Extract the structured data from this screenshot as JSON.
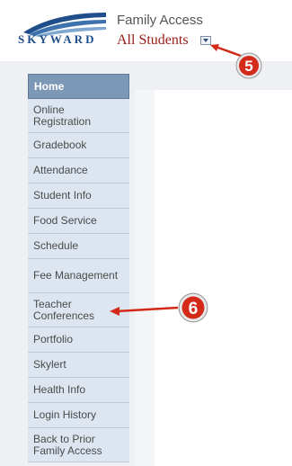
{
  "header": {
    "logo_text": "SKYWARD",
    "app_title": "Family Access",
    "student_selector": "All Students"
  },
  "sidebar": {
    "items": [
      {
        "label": "Home",
        "active": true
      },
      {
        "label": "Online Registration"
      },
      {
        "label": "Gradebook"
      },
      {
        "label": "Attendance"
      },
      {
        "label": "Student Info"
      },
      {
        "label": "Food Service"
      },
      {
        "label": "Schedule"
      },
      {
        "label": "Fee Management"
      },
      {
        "label": "Teacher Conferences"
      },
      {
        "label": "Portfolio"
      },
      {
        "label": "Skylert"
      },
      {
        "label": "Health Info"
      },
      {
        "label": "Login History"
      },
      {
        "label": "Back to Prior Family Access"
      }
    ]
  },
  "callouts": [
    {
      "number": "5"
    },
    {
      "number": "6"
    }
  ],
  "colors": {
    "brand_blue": "#1f4e8a",
    "student_red": "#9a1a12",
    "callout_red": "#d42a1a",
    "nav_active": "#7d97b6",
    "nav_bg": "#dde6f0"
  }
}
